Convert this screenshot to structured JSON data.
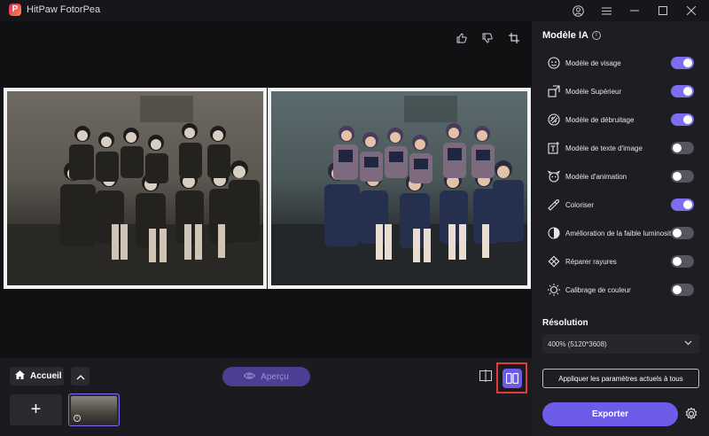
{
  "app": {
    "title": "HitPaw FotorPea",
    "logo_letter": "P"
  },
  "window_controls": [
    "user-icon",
    "menu-icon",
    "minimize-icon",
    "maximize-icon",
    "close-icon"
  ],
  "toolbar": {
    "icons": [
      "thumbs-up-icon",
      "thumbs-down-icon",
      "crop-icon"
    ]
  },
  "bottom": {
    "home_label": "Accueil",
    "preview_label": "Aperçu",
    "add_label": "+"
  },
  "panel": {
    "title": "Modèle IA",
    "models": [
      {
        "label": "Modèle de visage",
        "icon": "face-icon",
        "on": true
      },
      {
        "label": "Modèle Supérieur",
        "icon": "upscale-icon",
        "on": true
      },
      {
        "label": "Modèle de débruitage",
        "icon": "denoise-icon",
        "on": true
      },
      {
        "label": "Modèle de texte d'image",
        "icon": "text-image-icon",
        "on": false
      },
      {
        "label": "Modèle d'animation",
        "icon": "animation-icon",
        "on": false
      },
      {
        "label": "Coloriser",
        "icon": "colorize-icon",
        "on": true
      },
      {
        "label": "Amélioration de la faible luminosité",
        "icon": "low-light-icon",
        "on": false
      },
      {
        "label": "Réparer rayures",
        "icon": "scratch-repair-icon",
        "on": false
      },
      {
        "label": "Calibrage de couleur",
        "icon": "color-calibration-icon",
        "on": false
      }
    ],
    "resolution_title": "Résolution",
    "resolution_value": "400% (5120*3608)",
    "apply_label": "Appliquer les paramètres actuels à tous",
    "export_label": "Exporter"
  },
  "colors": {
    "accent": "#6c5ce7",
    "highlight": "#e23a3a"
  }
}
